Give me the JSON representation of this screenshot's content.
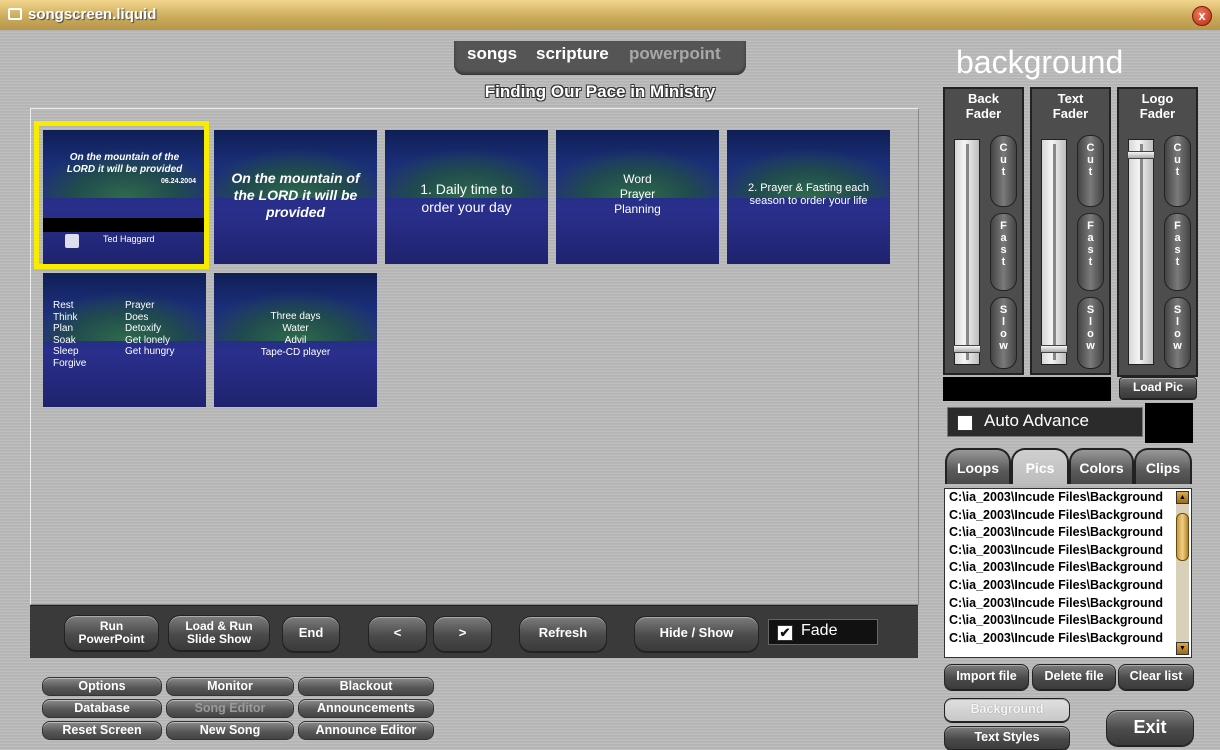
{
  "window": {
    "title": "songscreen.liquid",
    "close_glyph": "x"
  },
  "mode_tabs": [
    {
      "label": "songs",
      "color": "#ffffff"
    },
    {
      "label": "scripture",
      "color": "#ffffff"
    },
    {
      "label": "powerpoint",
      "color": "#9a9a9a"
    }
  ],
  "presentation_title": "Finding Our Pace in Ministry",
  "slides": [
    {
      "lines": [
        "On the mountain of the",
        "LORD it will be provided"
      ],
      "date": "06.24.2004",
      "footer": "Ted Haggard"
    },
    {
      "lines": [
        "On the mountain of",
        "the LORD it will be",
        "provided"
      ]
    },
    {
      "lines": [
        "1. Daily time to",
        "order your day"
      ]
    },
    {
      "lines": [
        "Word",
        "Prayer",
        "Planning"
      ]
    },
    {
      "lines": [
        "2. Prayer & Fasting each",
        "season to order your life"
      ]
    },
    {
      "col1": [
        "Rest",
        "Think",
        "Plan",
        "Soak",
        "Sleep",
        "Forgive"
      ],
      "col2": [
        "Prayer",
        "Does",
        "Detoxify",
        "Get lonely",
        "Get hungry"
      ]
    },
    {
      "lines": [
        "Three days",
        "Water",
        "Advil",
        "Tape-CD player"
      ]
    }
  ],
  "controls": {
    "run_powerpoint": [
      "Run",
      "PowerPoint"
    ],
    "load_run": [
      "Load & Run",
      "Slide Show"
    ],
    "end": "End",
    "prev": "<",
    "next": ">",
    "refresh": "Refresh",
    "hide_show": "Hide / Show",
    "fade": {
      "label": "Fade",
      "checked": true
    }
  },
  "menu": {
    "options": "Options",
    "monitor": "Monitor",
    "blackout": "Blackout",
    "database": "Database",
    "song_editor": "Song Editor",
    "announcements": "Announcements",
    "reset_screen": "Reset Screen",
    "new_song": "New Song",
    "announce_editor": "Announce Editor"
  },
  "background_panel": {
    "title": "background",
    "faders": [
      {
        "label": [
          "Back",
          "Fader"
        ],
        "level": 0.04
      },
      {
        "label": [
          "Text",
          "Fader"
        ],
        "level": 0.04
      },
      {
        "label": [
          "Logo",
          "Fader"
        ],
        "level": 0.97
      }
    ],
    "fader_buttons": {
      "cut": "Cut",
      "fast": "Fast",
      "slow": "Slow"
    },
    "load_pic": "Load Pic",
    "auto_advance": {
      "label": "Auto Advance",
      "checked": false
    },
    "tabs": [
      "Loops",
      "Pics",
      "Colors",
      "Clips"
    ],
    "active_tab": "Pics",
    "files": [
      "C:\\ia_2003\\Incude Files\\Background",
      "C:\\ia_2003\\Incude Files\\Background",
      "C:\\ia_2003\\Incude Files\\Background",
      "C:\\ia_2003\\Incude Files\\Background",
      "C:\\ia_2003\\Incude Files\\Background",
      "C:\\ia_2003\\Incude Files\\Background",
      "C:\\ia_2003\\Incude Files\\Background",
      "C:\\ia_2003\\Incude Files\\Background",
      "C:\\ia_2003\\Incude Files\\Background"
    ],
    "import_file": "Import file",
    "delete_file": "Delete file",
    "clear_list": "Clear list",
    "background_btn": "Background",
    "text_styles": "Text Styles",
    "exit": "Exit"
  }
}
